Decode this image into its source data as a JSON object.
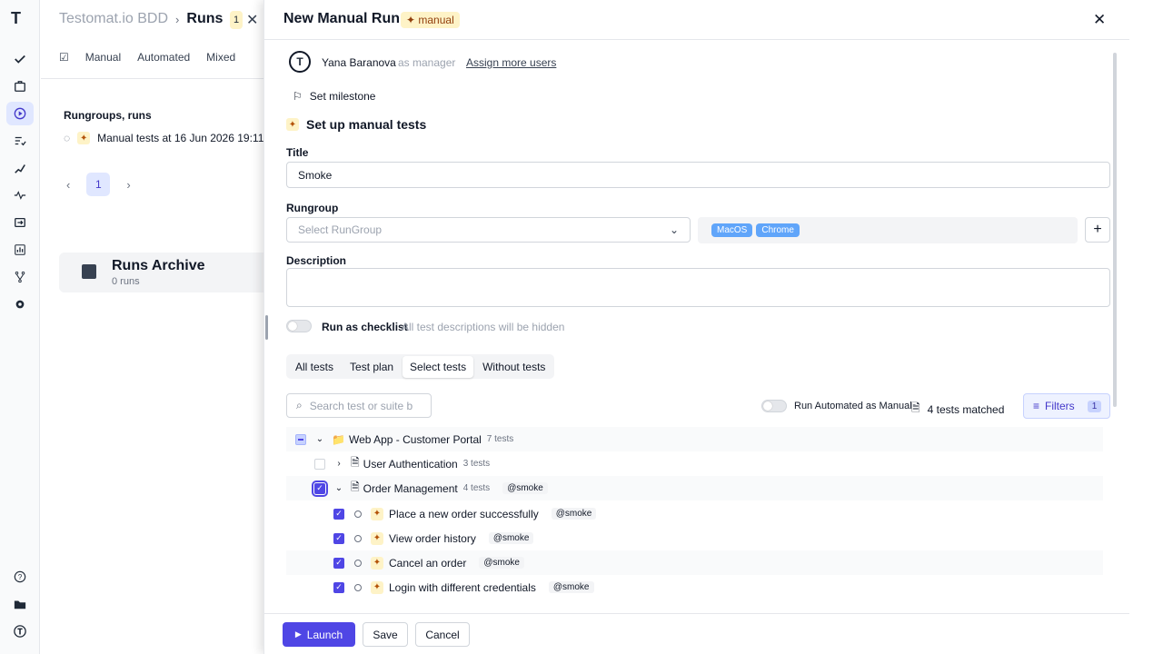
{
  "rail": {
    "logo": "T",
    "items": [
      "check-icon",
      "briefcase-icon",
      "play-icon",
      "list-check-icon",
      "steps-icon",
      "pulse-icon",
      "import-icon",
      "chart-icon",
      "branch-icon",
      "gear-icon",
      "help-icon",
      "folder-icon",
      "avatar-icon"
    ],
    "active": "play-icon"
  },
  "background": {
    "project": "Testomat.io BDD",
    "page": "Runs",
    "tabs": [
      "Manual",
      "Automated",
      "Mixed"
    ],
    "rungroups_title": "Rungroups, runs",
    "run_item": "Manual tests at 16 Jun 2026 19:11",
    "page_number": "1",
    "archive_title": "Runs Archive",
    "archive_subtitle": "0 runs",
    "badge": "1"
  },
  "panel": {
    "title": "New Manual Run",
    "badge": "manual",
    "manager_name": "Yana Baranova",
    "manager_role": "as manager",
    "assign_link": "Assign more users",
    "milestone": "Set milestone",
    "setup_title": "Set up manual tests",
    "title_label": "Title",
    "title_value": "Smoke",
    "rungroup_label": "Rungroup",
    "rungroup_placeholder": "Select RunGroup",
    "env_tags": [
      "MacOS",
      "Chrome"
    ],
    "description_label": "Description",
    "checklist_label": "Run as checklist",
    "checklist_hint": "All test descriptions will be hidden",
    "scope_tabs": [
      "All tests",
      "Test plan",
      "Select tests",
      "Without tests"
    ],
    "active_scope": "Select tests",
    "search_placeholder": "Search test or suite b",
    "automated_label": "Run Automated as Manual",
    "matched": "4 tests matched",
    "filters_label": "Filters",
    "filters_count": "1",
    "tree": {
      "root": {
        "name": "Web App - Customer Portal",
        "count": "7 tests"
      },
      "suites": [
        {
          "name": "User Authentication",
          "count": "3 tests"
        },
        {
          "name": "Order Management",
          "count": "4 tests",
          "tag": "@smoke"
        }
      ],
      "tests": [
        {
          "name": "Place a new order successfully",
          "tag": "@smoke"
        },
        {
          "name": "View order history",
          "tag": "@smoke"
        },
        {
          "name": "Cancel an order",
          "tag": "@smoke"
        },
        {
          "name": "Login with different credentials",
          "tag": "@smoke"
        }
      ]
    },
    "launch": "Launch",
    "save": "Save",
    "cancel": "Cancel"
  },
  "colors": {
    "accent": "#4f46e5",
    "tag_blue": "#60a5fa",
    "manual_bg": "#fef3c7"
  }
}
